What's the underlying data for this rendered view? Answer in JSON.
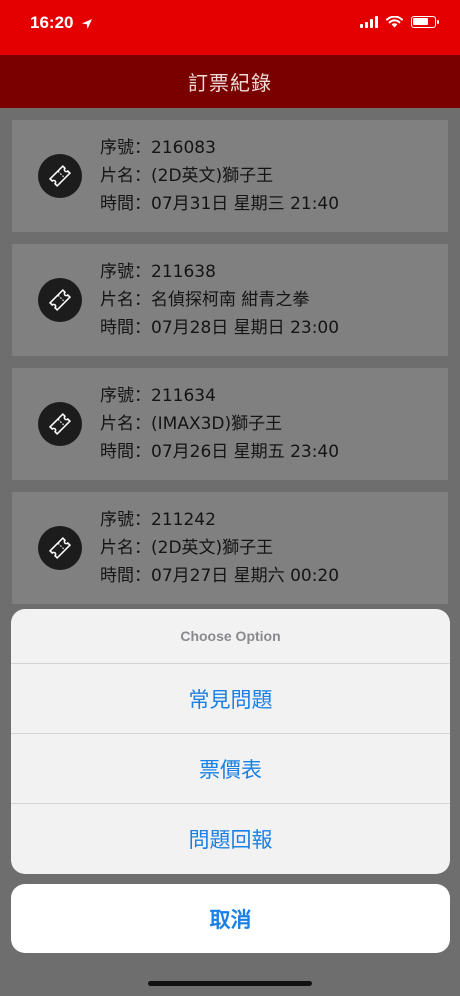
{
  "status_bar": {
    "time": "16:20"
  },
  "nav": {
    "title": "訂票紀錄"
  },
  "records": [
    {
      "serial": "序號：216083",
      "title": "片名：(2D英文)獅子王",
      "time": "時間：07月31日 星期三 21:40"
    },
    {
      "serial": "序號：211638",
      "title": "片名：名偵探柯南 紺青之拳",
      "time": "時間：07月28日 星期日 23:00"
    },
    {
      "serial": "序號：211634",
      "title": "片名：(IMAX3D)獅子王",
      "time": "時間：07月26日 星期五 23:40"
    },
    {
      "serial": "序號：211242",
      "title": "片名：(2D英文)獅子王",
      "time": "時間：07月27日 星期六 00:20"
    }
  ],
  "action_sheet": {
    "title": "Choose Option",
    "options": [
      "常見問題",
      "票價表",
      "問題回報"
    ],
    "cancel": "取消"
  },
  "colors": {
    "status_bar": "#e40000",
    "nav_bar": "#7a0000",
    "action_text": "#1a80e6"
  }
}
